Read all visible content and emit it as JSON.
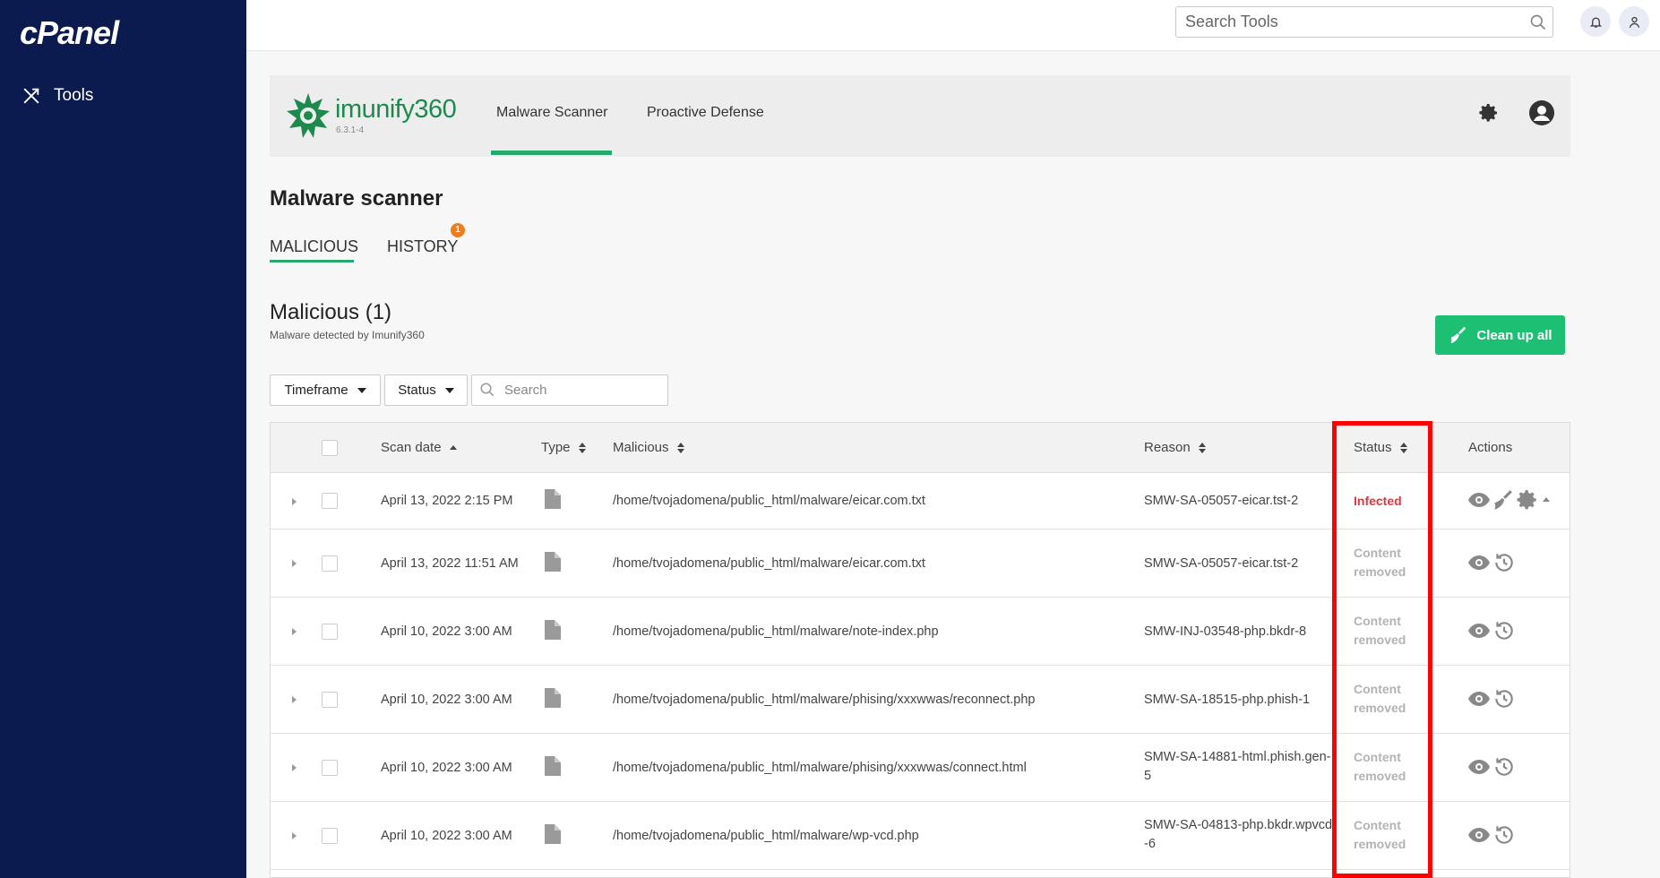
{
  "sidebar": {
    "logo": "cPanel",
    "tools_label": "Tools"
  },
  "topbar": {
    "search_placeholder": "Search Tools"
  },
  "imunify": {
    "brand_name": "imunify360",
    "version": "6.3.1-4",
    "tabs": [
      {
        "label": "Malware Scanner",
        "active": true
      },
      {
        "label": "Proactive Defense",
        "active": false
      }
    ]
  },
  "page": {
    "title": "Malware scanner",
    "subtabs": [
      {
        "label": "MALICIOUS",
        "active": true
      },
      {
        "label": "HISTORY",
        "badge": "1"
      }
    ],
    "section_title": "Malicious (1)",
    "section_subtitle": "Malware detected by Imunify360",
    "cleanup_label": "Clean up all"
  },
  "filters": {
    "timeframe_label": "Timeframe",
    "status_label": "Status",
    "search_placeholder": "Search"
  },
  "table": {
    "headers": {
      "scan_date": "Scan date",
      "type": "Type",
      "malicious": "Malicious",
      "reason": "Reason",
      "status": "Status",
      "actions": "Actions"
    },
    "rows": [
      {
        "date": "April 13, 2022 2:15 PM",
        "path": "/home/tvojadomena/public_html/malware/eicar.com.txt",
        "reason": [
          "SMW-SA-05057-eicar.tst-2"
        ],
        "status": "Infected",
        "infected": true
      },
      {
        "date": "April 13, 2022 11:51 AM",
        "path": "/home/tvojadomena/public_html/malware/eicar.com.txt",
        "reason": [
          "SMW-SA-05057-eicar.tst-2"
        ],
        "status_lines": [
          "Content",
          "removed"
        ],
        "infected": false
      },
      {
        "date": "April 10, 2022 3:00 AM",
        "path": "/home/tvojadomena/public_html/malware/note-index.php",
        "reason": [
          "SMW-INJ-03548-php.bkdr-8"
        ],
        "status_lines": [
          "Content",
          "removed"
        ],
        "infected": false
      },
      {
        "date": "April 10, 2022 3:00 AM",
        "path": "/home/tvojadomena/public_html/malware/phising/xxxwwas/reconnect.php",
        "reason": [
          "SMW-SA-18515-php.phish-1"
        ],
        "status_lines": [
          "Content",
          "removed"
        ],
        "infected": false
      },
      {
        "date": "April 10, 2022 3:00 AM",
        "path": "/home/tvojadomena/public_html/malware/phising/xxxwwas/connect.html",
        "reason": [
          "SMW-SA-14881-html.phish.gen-",
          "5"
        ],
        "status_lines": [
          "Content",
          "removed"
        ],
        "infected": false
      },
      {
        "date": "April 10, 2022 3:00 AM",
        "path": "/home/tvojadomena/public_html/malware/wp-vcd.php",
        "reason": [
          "SMW-SA-04813-php.bkdr.wpvcd",
          "-6"
        ],
        "status_lines": [
          "Content",
          "removed"
        ],
        "infected": false
      }
    ]
  },
  "icons": {
    "search": "search-icon",
    "bell": "bell-icon",
    "user": "user-icon",
    "gear": "gear-icon",
    "file": "file-icon",
    "eye": "eye-icon",
    "broom": "broom-icon",
    "history": "history-icon",
    "tools": "tools-icon"
  },
  "colors": {
    "sidebar": "#0c1b4f",
    "accent_green": "#26a96c",
    "cleanup_green": "#1dbf73",
    "infected_red": "#e8343d",
    "badge_orange": "#f27c1a",
    "highlight_red": "#ff0000"
  }
}
